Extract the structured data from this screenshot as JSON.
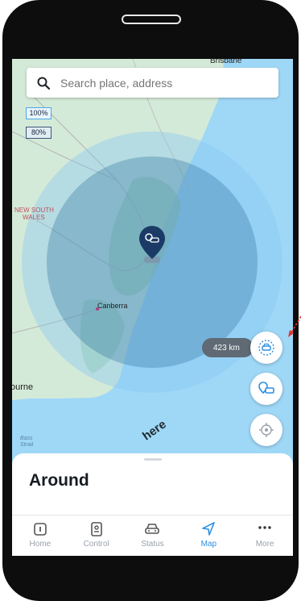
{
  "search": {
    "placeholder": "Search place, address"
  },
  "map": {
    "legend": [
      "100%",
      "80%"
    ],
    "labels": {
      "brisbane": "Brisbane",
      "nsw_line1": "NEW SOUTH",
      "nsw_line2": "WALES",
      "canberra": "Canberra",
      "bourne": "ourne",
      "bass_line1": "Bass",
      "bass_line2": "Strait"
    },
    "provider_logo": "here",
    "range_text": "423 km",
    "colors": {
      "sea": "#9fd8f7",
      "land": "#d4ead8",
      "range_outer": "#86c7f2",
      "range_inner": "#2f6f9e",
      "pin": "#1b3b66"
    }
  },
  "sheet": {
    "title": "Around"
  },
  "tabs": [
    {
      "label": "Home",
      "icon": "home-icon",
      "active": false
    },
    {
      "label": "Control",
      "icon": "control-icon",
      "active": false
    },
    {
      "label": "Status",
      "icon": "car-icon",
      "active": false
    },
    {
      "label": "Map",
      "icon": "navigation-arrow-icon",
      "active": true
    },
    {
      "label": "More",
      "icon": "more-dots-icon",
      "active": false
    }
  ]
}
